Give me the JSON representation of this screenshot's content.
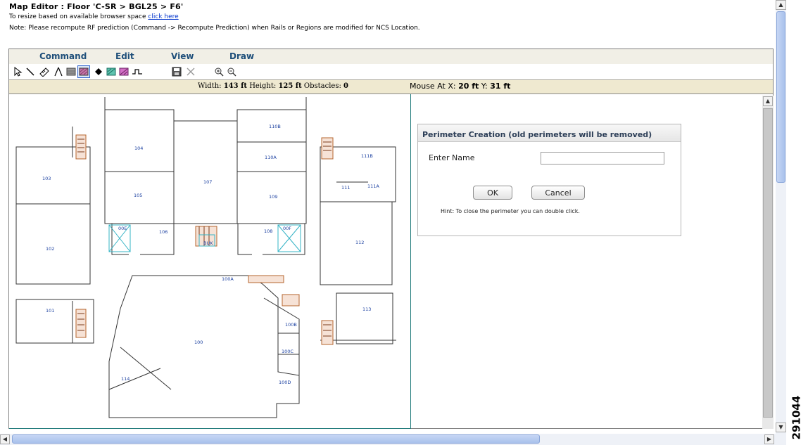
{
  "header": {
    "title": "Map Editor : Floor 'C-SR > BGL25 > F6'",
    "resize_text": "To resize based on available browser space",
    "resize_link": "click here",
    "note": "Note: Please recompute RF prediction (Command -> Recompute Prediction) when Rails or Regions are modified for NCS Location."
  },
  "menu": {
    "command": "Command",
    "edit": "Edit",
    "view": "View",
    "draw": "Draw"
  },
  "toolbar": {
    "tools": [
      "select-icon",
      "line-icon",
      "ruler-icon",
      "compass-icon",
      "wall-icon",
      "perimeter-icon",
      "point-icon",
      "coverage-icon",
      "region-icon",
      "rail-icon",
      "save-icon",
      "delete-icon",
      "zoom-in-icon",
      "zoom-out-icon"
    ],
    "active_tool": "perimeter-icon"
  },
  "infobar": {
    "width_label": "Width:",
    "width_value": "143 ft",
    "height_label": "Height:",
    "height_value": "125 ft",
    "obstacles_label": "Obstacles:",
    "obstacles_value": "0",
    "mouse_label": "Mouse At X:",
    "mouse_x": "20 ft",
    "mouse_y_label": "Y:",
    "mouse_y": "31 ft"
  },
  "floorplan": {
    "rooms": [
      "110B",
      "104",
      "110A",
      "111B",
      "103",
      "107",
      "111",
      "111A",
      "105",
      "109",
      "00E",
      "106",
      "108",
      "00F",
      "112",
      "102",
      "BUK",
      "100A",
      "101",
      "113",
      "100B",
      "100",
      "100C",
      "114",
      "100D"
    ]
  },
  "dialog": {
    "title": "Perimeter Creation (old perimeters will be removed)",
    "name_label": "Enter Name",
    "name_value": "",
    "ok": "OK",
    "cancel": "Cancel",
    "hint": "Hint: To close the perimeter you can double click."
  },
  "figure_id": "291044",
  "colors": {
    "menu_text": "#1f4f7a",
    "infobar_bg": "#efe9d0",
    "room_label": "#1a3fa0",
    "canvas_border": "#1f7a7a",
    "stairs": "#b5652f",
    "elevator": "#35b4c6"
  }
}
